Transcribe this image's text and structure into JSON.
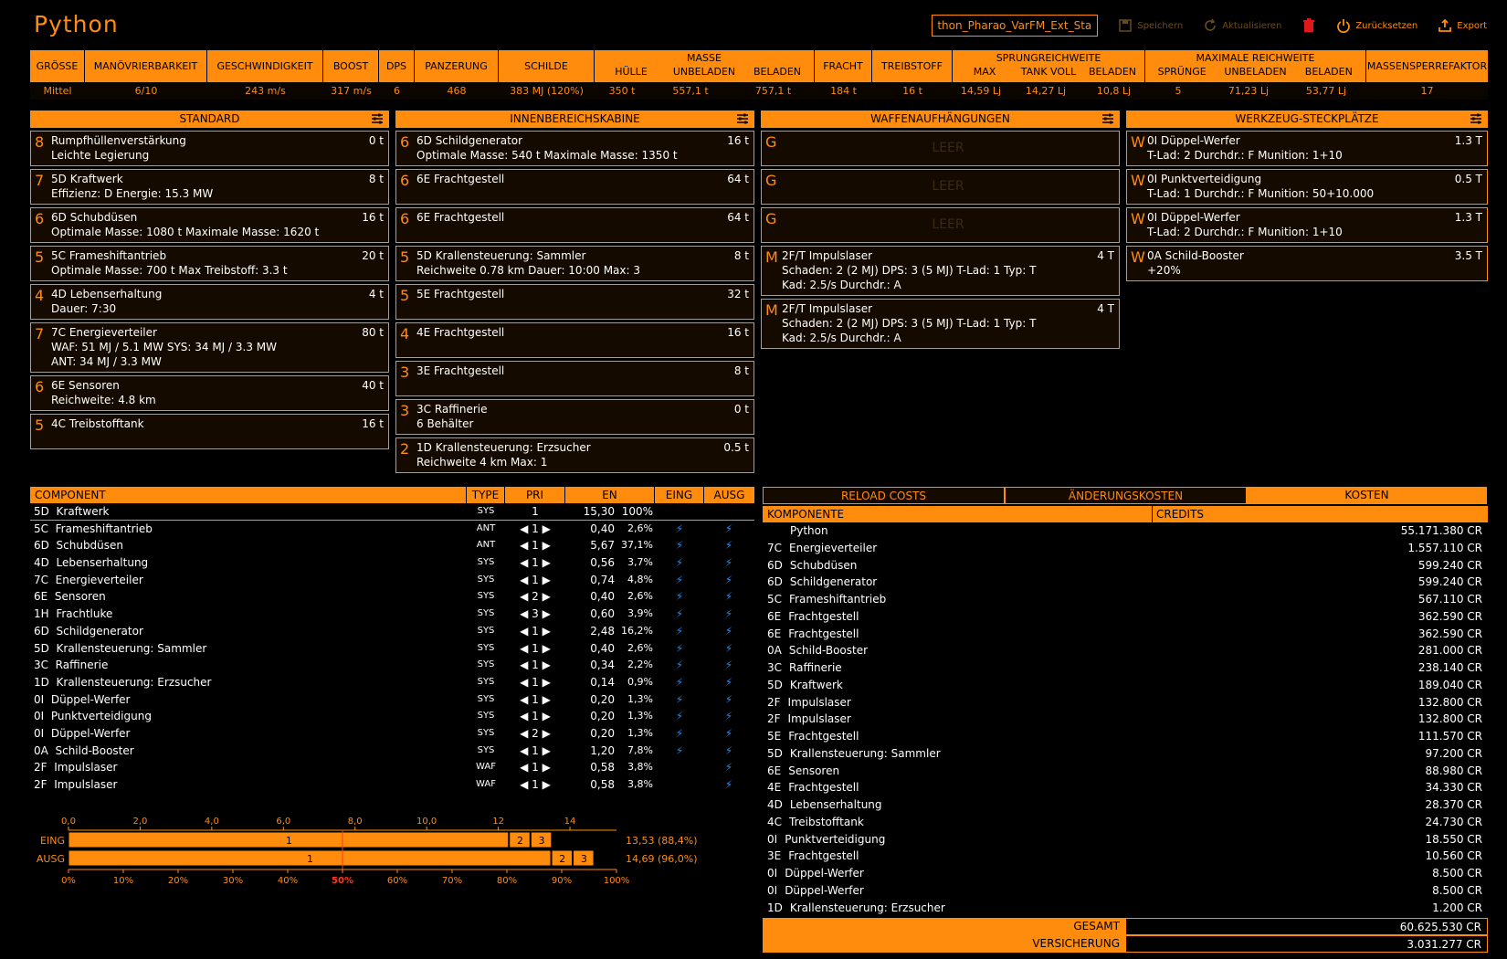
{
  "app": {
    "title": "Python"
  },
  "toolbar": {
    "build_name": "thon_Pharao_VarFM_Ext_Start",
    "save": "Speichern",
    "refresh": "Aktualisieren",
    "reset": "Zurücksetzen",
    "export": "Export"
  },
  "stats": {
    "headers": {
      "size": "GRÖSSE",
      "agility": "MANÖVRIERBARKEIT",
      "speed": "GESCHWINDIGKEIT",
      "boost": "BOOST",
      "dps": "DPS",
      "armour": "PANZERUNG",
      "shields": "SCHILDE",
      "mass": "MASSE",
      "hull": "HÜLLE",
      "unladen": "UNBELADEN",
      "laden": "BELADEN",
      "cargo": "FRACHT",
      "fuel": "TREIBSTOFF",
      "jump": "SPRUNGREICHWEITE",
      "max": "MAX",
      "full_tank": "TANK VOLL",
      "laden2": "BELADEN",
      "range": "MAXIMALE REICHWEITE",
      "jumps": "SPRÜNGE",
      "unladen2": "UNBELADEN",
      "laden3": "BELADEN",
      "mlf": "MASSENSPERREFAKTOR"
    },
    "values": {
      "size": "Mittel",
      "agility": "6/10",
      "speed": "243 m/s",
      "boost": "317 m/s",
      "dps": "6",
      "armour": "468",
      "shields": "383 MJ (120%)",
      "hull": "350 t",
      "unladen": "557,1 t",
      "laden": "757,1 t",
      "cargo": "184 t",
      "fuel": "16 t",
      "max": "14,59 Lj",
      "full_tank": "14,27 Lj",
      "laden2": "10,8 Lj",
      "jumps": "5",
      "unladen2": "71,23 Lj",
      "laden3": "53,77 Lj",
      "mlf": "17"
    }
  },
  "standard": {
    "title": "STANDARD",
    "slots": [
      {
        "size": "8",
        "name": "Rumpfhüllenverstärkung",
        "mass": "0 t",
        "info": [
          "Leichte Legierung"
        ]
      },
      {
        "size": "7",
        "name": "5D Kraftwerk",
        "mass": "8 t",
        "info": [
          "Effizienz: D  Energie: 15.3 MW"
        ]
      },
      {
        "size": "6",
        "name": "6D Schubdüsen",
        "mass": "16 t",
        "info": [
          "Optimale Masse: 1080 t  Maximale Masse: 1620 t"
        ]
      },
      {
        "size": "5",
        "name": "5C Frameshiftantrieb",
        "mass": "20 t",
        "info": [
          "Optimale Masse: 700 t  Max Treibstoff: 3.3 t"
        ]
      },
      {
        "size": "4",
        "name": "4D Lebenserhaltung",
        "mass": "4 t",
        "info": [
          "Dauer: 7:30"
        ]
      },
      {
        "size": "7",
        "name": "7C Energieverteiler",
        "mass": "80 t",
        "info": [
          "WAF: 51 MJ / 5.1 MW  SYS: 34 MJ / 3.3 MW",
          "ANT: 34 MJ / 3.3 MW"
        ]
      },
      {
        "size": "6",
        "name": "6E Sensoren",
        "mass": "40 t",
        "info": [
          "Reichweite: 4.8 km"
        ]
      },
      {
        "size": "5",
        "name": "4C Treibstofftank",
        "mass": "16 t",
        "info": [
          ""
        ]
      }
    ]
  },
  "internal": {
    "title": "INNENBEREICHSKABINE",
    "slots": [
      {
        "size": "6",
        "name": "6D Schildgenerator",
        "mass": "16 t",
        "info": [
          "Optimale Masse: 540 t  Maximale Masse: 1350 t"
        ]
      },
      {
        "size": "6",
        "name": "6E Frachtgestell",
        "mass": "64 t",
        "info": [
          ""
        ]
      },
      {
        "size": "6",
        "name": "6E Frachtgestell",
        "mass": "64 t",
        "info": [
          ""
        ]
      },
      {
        "size": "5",
        "name": "5D Krallensteuerung: Sammler",
        "mass": "8 t",
        "info": [
          "Reichweite 0.78 km  Dauer: 10:00  Max: 3"
        ]
      },
      {
        "size": "5",
        "name": "5E Frachtgestell",
        "mass": "32 t",
        "info": [
          ""
        ]
      },
      {
        "size": "4",
        "name": "4E Frachtgestell",
        "mass": "16 t",
        "info": [
          ""
        ]
      },
      {
        "size": "3",
        "name": "3E Frachtgestell",
        "mass": "8 t",
        "info": [
          ""
        ]
      },
      {
        "size": "3",
        "name": "3C Raffinerie",
        "mass": "0 t",
        "info": [
          "6 Behälter"
        ]
      },
      {
        "size": "2",
        "name": "1D Krallensteuerung: Erzsucher",
        "mass": "0.5 t",
        "info": [
          "Reichweite 4 km  Max: 1"
        ]
      }
    ]
  },
  "hardpoints": {
    "title": "WAFFENAUFHÄNGUNGEN",
    "empty_label": "LEER",
    "slots": [
      {
        "size": "G",
        "empty": true
      },
      {
        "size": "G",
        "empty": true
      },
      {
        "size": "G",
        "empty": true
      },
      {
        "size": "M",
        "name": "2F/T Impulslaser",
        "mass": "4 T",
        "info": [
          "Schaden: 2 (2 MJ)  DPS: 3 (5 MJ)  T-Lad: 1  Typ: T",
          "Kad: 2.5/s  Durchdr.: A"
        ]
      },
      {
        "size": "M",
        "name": "2F/T Impulslaser",
        "mass": "4 T",
        "info": [
          "Schaden: 2 (2 MJ)  DPS: 3 (5 MJ)  T-Lad: 1  Typ: T",
          "Kad: 2.5/s  Durchdr.: A"
        ]
      }
    ]
  },
  "utility": {
    "title": "WERKZEUG-STECKPLÄTZE",
    "slots": [
      {
        "size": "W",
        "name": "0I Düppel-Werfer",
        "mass": "1.3 T",
        "info": [
          "T-Lad: 2  Durchdr.: F  Munition: 1+10"
        ]
      },
      {
        "size": "W",
        "name": "0I Punktverteidigung",
        "mass": "0.5 T",
        "info": [
          "T-Lad: 1  Durchdr.: F  Munition: 50+10.000"
        ]
      },
      {
        "size": "W",
        "name": "0I Düppel-Werfer",
        "mass": "1.3 T",
        "info": [
          "T-Lad: 2  Durchdr.: F  Munition: 1+10"
        ]
      },
      {
        "size": "W",
        "name": "0A Schild-Booster",
        "mass": "3.5 T",
        "info": [
          "+20%"
        ]
      }
    ]
  },
  "power": {
    "headers": {
      "component": "COMPONENT",
      "type": "TYPE",
      "pri": "PRI",
      "en": "EN",
      "eing": "EING",
      "ausg": "AUSG"
    },
    "first": {
      "grade": "5D",
      "name": "Kraftwerk",
      "type": "SYS",
      "pri": "1",
      "en": "15,30",
      "pct": "100%"
    },
    "rows": [
      {
        "grade": "5C",
        "name": "Frameshiftantrieb",
        "type": "ANT",
        "pri": "1",
        "en": "0,40",
        "pct": "2,6%",
        "eing": true,
        "ausg": true
      },
      {
        "grade": "6D",
        "name": "Schubdüsen",
        "type": "ANT",
        "pri": "1",
        "en": "5,67",
        "pct": "37,1%",
        "eing": true,
        "ausg": true
      },
      {
        "grade": "4D",
        "name": "Lebenserhaltung",
        "type": "SYS",
        "pri": "1",
        "en": "0,56",
        "pct": "3,7%",
        "eing": true,
        "ausg": true
      },
      {
        "grade": "7C",
        "name": "Energieverteiler",
        "type": "SYS",
        "pri": "1",
        "en": "0,74",
        "pct": "4,8%",
        "eing": true,
        "ausg": true
      },
      {
        "grade": "6E",
        "name": "Sensoren",
        "type": "SYS",
        "pri": "2",
        "en": "0,40",
        "pct": "2,6%",
        "eing": true,
        "ausg": true
      },
      {
        "grade": "1H",
        "name": "Frachtluke",
        "type": "SYS",
        "pri": "3",
        "en": "0,60",
        "pct": "3,9%",
        "eing": true,
        "ausg": true
      },
      {
        "grade": "6D",
        "name": "Schildgenerator",
        "type": "SYS",
        "pri": "1",
        "en": "2,48",
        "pct": "16,2%",
        "eing": true,
        "ausg": true
      },
      {
        "grade": "5D",
        "name": "Krallensteuerung: Sammler",
        "type": "SYS",
        "pri": "1",
        "en": "0,40",
        "pct": "2,6%",
        "eing": true,
        "ausg": true
      },
      {
        "grade": "3C",
        "name": "Raffinerie",
        "type": "SYS",
        "pri": "1",
        "en": "0,34",
        "pct": "2,2%",
        "eing": true,
        "ausg": true
      },
      {
        "grade": "1D",
        "name": "Krallensteuerung: Erzsucher",
        "type": "SYS",
        "pri": "1",
        "en": "0,14",
        "pct": "0,9%",
        "eing": true,
        "ausg": true
      },
      {
        "grade": "0I",
        "name": "Düppel-Werfer",
        "type": "SYS",
        "pri": "1",
        "en": "0,20",
        "pct": "1,3%",
        "eing": true,
        "ausg": true
      },
      {
        "grade": "0I",
        "name": "Punktverteidigung",
        "type": "SYS",
        "pri": "1",
        "en": "0,20",
        "pct": "1,3%",
        "eing": true,
        "ausg": true
      },
      {
        "grade": "0I",
        "name": "Düppel-Werfer",
        "type": "SYS",
        "pri": "2",
        "en": "0,20",
        "pct": "1,3%",
        "eing": true,
        "ausg": true
      },
      {
        "grade": "0A",
        "name": "Schild-Booster",
        "type": "SYS",
        "pri": "1",
        "en": "1,20",
        "pct": "7,8%",
        "eing": true,
        "ausg": true
      },
      {
        "grade": "2F",
        "name": "Impulslaser",
        "type": "WAF",
        "pri": "1",
        "en": "0,58",
        "pct": "3,8%",
        "eing": false,
        "ausg": true
      },
      {
        "grade": "2F",
        "name": "Impulslaser",
        "type": "WAF",
        "pri": "1",
        "en": "0,58",
        "pct": "3,8%",
        "eing": false,
        "ausg": true
      }
    ]
  },
  "chart_data": {
    "type": "bar",
    "x_ticks_top": [
      "0,0",
      "2,0",
      "4,0",
      "6,0",
      "8,0",
      "10,0",
      "12",
      "14"
    ],
    "x_ticks_bottom": [
      "0%",
      "10%",
      "20%",
      "30%",
      "40%",
      "50%",
      "60%",
      "70%",
      "80%",
      "90%",
      "100%"
    ],
    "highlight_tick": "50%",
    "xlim": [
      0,
      15.3
    ],
    "series": [
      {
        "name": "EING",
        "segments": [
          {
            "label": "1",
            "value": 12.31
          },
          {
            "label": "2",
            "value": 0.6
          },
          {
            "label": "3",
            "value": 0.6
          }
        ],
        "total_label": "13,53 (88,4%)"
      },
      {
        "name": "AUSG",
        "segments": [
          {
            "label": "1",
            "value": 13.49
          },
          {
            "label": "2",
            "value": 0.6
          },
          {
            "label": "3",
            "value": 0.6
          }
        ],
        "total_label": "14,69 (96,0%)"
      }
    ]
  },
  "costs": {
    "tabs": [
      "RELOAD COSTS",
      "ÄNDERUNGSKOSTEN",
      "KOSTEN"
    ],
    "headers": {
      "component": "KOMPONENTE",
      "credits": "CREDITS"
    },
    "rows": [
      {
        "grade": "",
        "name": "Python",
        "value": "55.171.380 CR"
      },
      {
        "grade": "7C",
        "name": "Energieverteiler",
        "value": "1.557.110 CR"
      },
      {
        "grade": "6D",
        "name": "Schubdüsen",
        "value": "599.240 CR"
      },
      {
        "grade": "6D",
        "name": "Schildgenerator",
        "value": "599.240 CR"
      },
      {
        "grade": "5C",
        "name": "Frameshiftantrieb",
        "value": "567.110 CR"
      },
      {
        "grade": "6E",
        "name": "Frachtgestell",
        "value": "362.590 CR"
      },
      {
        "grade": "6E",
        "name": "Frachtgestell",
        "value": "362.590 CR"
      },
      {
        "grade": "0A",
        "name": "Schild-Booster",
        "value": "281.000 CR"
      },
      {
        "grade": "3C",
        "name": "Raffinerie",
        "value": "238.140 CR"
      },
      {
        "grade": "5D",
        "name": "Kraftwerk",
        "value": "189.040 CR"
      },
      {
        "grade": "2F",
        "name": "Impulslaser",
        "value": "132.800 CR"
      },
      {
        "grade": "2F",
        "name": "Impulslaser",
        "value": "132.800 CR"
      },
      {
        "grade": "5E",
        "name": "Frachtgestell",
        "value": "111.570 CR"
      },
      {
        "grade": "5D",
        "name": "Krallensteuerung: Sammler",
        "value": "97.200 CR"
      },
      {
        "grade": "6E",
        "name": "Sensoren",
        "value": "88.980 CR"
      },
      {
        "grade": "4E",
        "name": "Frachtgestell",
        "value": "34.330 CR"
      },
      {
        "grade": "4D",
        "name": "Lebenserhaltung",
        "value": "28.370 CR"
      },
      {
        "grade": "4C",
        "name": "Treibstofftank",
        "value": "24.730 CR"
      },
      {
        "grade": "0I",
        "name": "Punktverteidigung",
        "value": "18.550 CR"
      },
      {
        "grade": "3E",
        "name": "Frachtgestell",
        "value": "10.560 CR"
      },
      {
        "grade": "0I",
        "name": "Düppel-Werfer",
        "value": "8.500 CR"
      },
      {
        "grade": "0I",
        "name": "Düppel-Werfer",
        "value": "8.500 CR"
      },
      {
        "grade": "1D",
        "name": "Krallensteuerung: Erzsucher",
        "value": "1.200 CR"
      }
    ],
    "total_label": "GESAMT",
    "total": "60.625.530 CR",
    "insurance_label": "VERSICHERUNG",
    "insurance": "3.031.277 CR"
  }
}
